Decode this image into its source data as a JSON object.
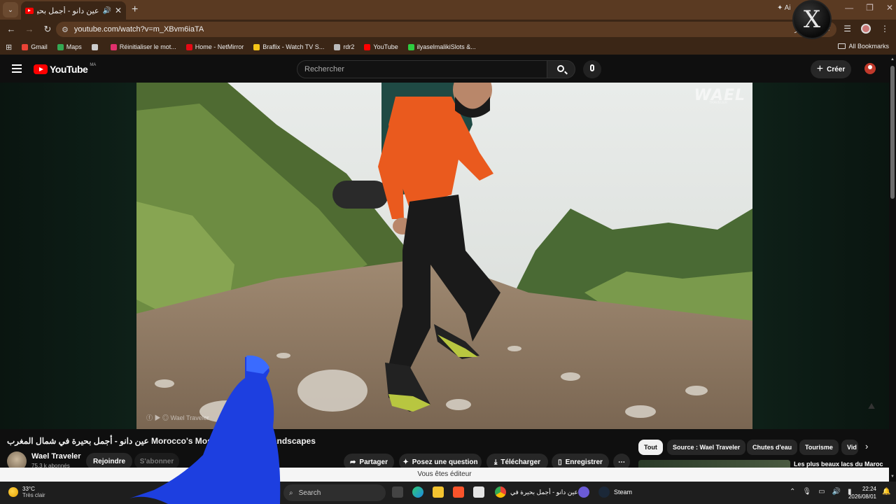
{
  "browser": {
    "tab_title": "عين دانو - أجمل بحيرة في ش",
    "url": "youtube.com/watch?v=m_XBvm6iaTA",
    "ai_badge": "Ai",
    "bookmarks": [
      {
        "label": "Gmail",
        "color": "#ea4335"
      },
      {
        "label": "Maps",
        "color": "#34a853"
      },
      {
        "label": "",
        "color": "#cccccc"
      },
      {
        "label": "Réinitialiser le mot...",
        "color": "#e1306c"
      },
      {
        "label": "Home - NetMirror",
        "color": "#e50914"
      },
      {
        "label": "Braflix - Watch TV S...",
        "color": "#f5c518"
      },
      {
        "label": "rdr2",
        "color": "#bbbbbb"
      },
      {
        "label": "YouTube",
        "color": "#ff0000"
      },
      {
        "label": "ilyaselmalikiSlots &...",
        "color": "#2ecc40"
      }
    ],
    "all_bookmarks": "All Bookmarks"
  },
  "youtube": {
    "logo_text": "YouTube",
    "country_code": "MA",
    "search_placeholder": "Rechercher",
    "create_label": "Créer",
    "watermark": "WAEL",
    "watermark_sub": "TRAVELER",
    "video_credit": "Wael Traveler",
    "video_title": "عين دانو - أجمل بحيرة في شمال المغرب Morocco's Most Breath... al | Landscapes",
    "channel_name": "Wael Traveler",
    "channel_subs": "75,3 k abonnés",
    "join_label": "Rejoindre",
    "subscribe_label": "S'abonner",
    "actions": {
      "share": "Partager",
      "ask": "Posez une question",
      "download": "Télécharger",
      "save": "Enregistrer",
      "more": "⋯"
    },
    "chips": [
      "Tout",
      "Source : Wael Traveler",
      "Chutes d'eau",
      "Tourisme",
      "Vid"
    ],
    "rec_title": "Les plus beaux lacs du Maroc",
    "toast": "Vous êtes éditeur"
  },
  "taskbar": {
    "temp": "33°C",
    "condition": "Très clair",
    "search": "Search",
    "app_label": "عين دانو - أجمل بحيرة في",
    "steam_label": "Steam",
    "time": "22:24",
    "date": "2026/08/01"
  }
}
